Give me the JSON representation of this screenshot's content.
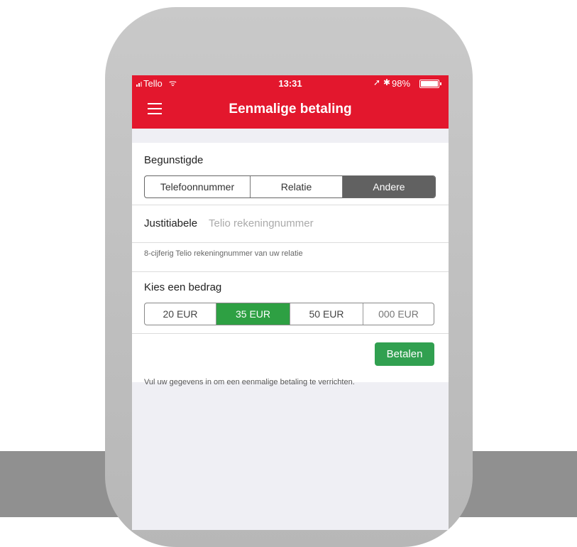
{
  "status_bar": {
    "carrier": "Tello",
    "time": "13:31",
    "battery": "98%",
    "icons": [
      "signal-icon",
      "wifi-icon",
      "location-icon",
      "bluetooth-icon",
      "battery-icon"
    ]
  },
  "header": {
    "title": "Eenmalige betaling",
    "menu_icon": "hamburger-menu-icon"
  },
  "beneficiary": {
    "label": "Begunstigde",
    "options": [
      "Telefoonnummer",
      "Relatie",
      "Andere"
    ],
    "selected": "Andere"
  },
  "account_field": {
    "label": "Justitiabele",
    "placeholder": "Telio rekeningnummer",
    "value": "",
    "hint": "8-cijferig Telio rekeningnummer van uw relatie"
  },
  "amount": {
    "label": "Kies een bedrag",
    "options": [
      "20 EUR",
      "35 EUR",
      "50 EUR",
      "000 EUR"
    ],
    "selected": "35 EUR"
  },
  "pay_button": {
    "label": "Betalen"
  },
  "footer": {
    "note": "Vul uw gegevens in om een eenmalige betaling te verrichten."
  },
  "colors": {
    "header_red": "#e3172d",
    "selected_green": "#2ea043",
    "selected_dark": "#616161",
    "background": "#efeff4"
  }
}
